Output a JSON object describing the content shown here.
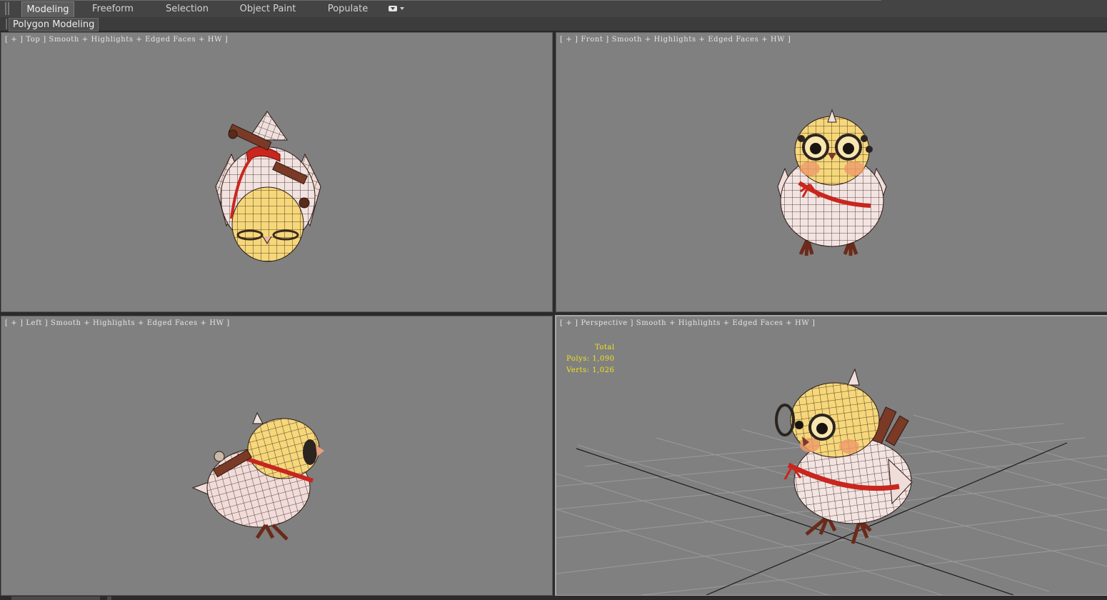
{
  "ribbon": {
    "tabs": [
      {
        "label": "Modeling",
        "active": true
      },
      {
        "label": "Freeform",
        "active": false
      },
      {
        "label": "Selection",
        "active": false
      },
      {
        "label": "Object Paint",
        "active": false
      },
      {
        "label": "Populate",
        "active": false
      }
    ],
    "menu_icon": "ribbon-options-icon",
    "panel_label": "Polygon Modeling"
  },
  "viewports": [
    {
      "name": "top",
      "label": "[ + ] Top ] Smooth + Highlights + Edged Faces + HW ]",
      "active": false
    },
    {
      "name": "front",
      "label": "[ + ] Front ] Smooth + Highlights + Edged Faces + HW ]",
      "active": false
    },
    {
      "name": "left",
      "label": "[ + ] Left ] Smooth + Highlights + Edged Faces + HW ]",
      "active": false
    },
    {
      "name": "perspective",
      "label": "[ + ] Perspective ] Smooth + Highlights + Edged Faces + HW ]",
      "active": true
    }
  ],
  "stats": {
    "title": "Total",
    "polys": "Polys: 1,090",
    "verts": "Verts: 1,026"
  },
  "colors": {
    "viewport_bg": "#808080",
    "stats_text": "#f2e21c",
    "ribbon_bg": "#444444",
    "body_white": "#f2e4e2",
    "head_yellow": "#f5d97a",
    "ribbon_red": "#c8261e"
  }
}
